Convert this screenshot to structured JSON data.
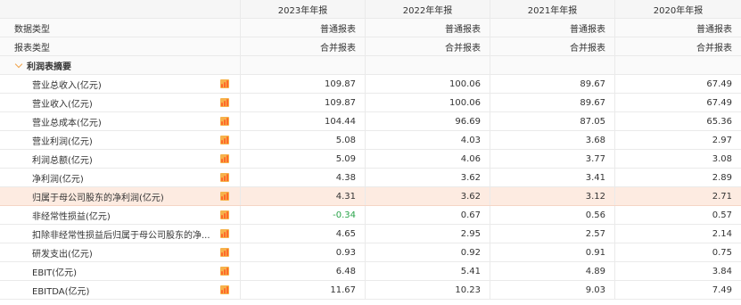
{
  "table": {
    "header": {
      "col0": "",
      "years": [
        "2023年年报",
        "2022年年报",
        "2021年年报",
        "2020年年报"
      ]
    },
    "meta_rows": [
      {
        "label": "数据类型",
        "values": [
          "普通报表",
          "普通报表",
          "普通报表",
          "普通报表"
        ]
      },
      {
        "label": "报表类型",
        "values": [
          "合并报表",
          "合并报表",
          "合并报表",
          "合并报表"
        ]
      }
    ],
    "section": {
      "title": "利润表摘要"
    },
    "rows": [
      {
        "label": "营业总收入(亿元)",
        "values": [
          "109.87",
          "100.06",
          "89.67",
          "67.49"
        ]
      },
      {
        "label": "营业收入(亿元)",
        "values": [
          "109.87",
          "100.06",
          "89.67",
          "67.49"
        ]
      },
      {
        "label": "营业总成本(亿元)",
        "values": [
          "104.44",
          "96.69",
          "87.05",
          "65.36"
        ]
      },
      {
        "label": "营业利润(亿元)",
        "values": [
          "5.08",
          "4.03",
          "3.68",
          "2.97"
        ]
      },
      {
        "label": "利润总额(亿元)",
        "values": [
          "5.09",
          "4.06",
          "3.77",
          "3.08"
        ]
      },
      {
        "label": "净利润(亿元)",
        "values": [
          "4.38",
          "3.62",
          "3.41",
          "2.89"
        ]
      },
      {
        "label": "归属于母公司股东的净利润(亿元)",
        "values": [
          "4.31",
          "3.62",
          "3.12",
          "2.71"
        ],
        "highlight": true
      },
      {
        "label": "非经常性损益(亿元)",
        "values": [
          "-0.34",
          "0.67",
          "0.56",
          "0.57"
        ]
      },
      {
        "label": "扣除非经常性损益后归属于母公司股东的净...",
        "values": [
          "4.65",
          "2.95",
          "2.57",
          "2.14"
        ]
      },
      {
        "label": "研发支出(亿元)",
        "values": [
          "0.93",
          "0.92",
          "0.91",
          "0.75"
        ]
      },
      {
        "label": "EBIT(亿元)",
        "values": [
          "6.48",
          "5.41",
          "4.89",
          "3.84"
        ]
      },
      {
        "label": "EBITDA(亿元)",
        "values": [
          "11.67",
          "10.23",
          "9.03",
          "7.49"
        ]
      }
    ]
  },
  "icons": {
    "section_toggle": "chevron-down-icon",
    "metric_chart": "bar-chart-icon"
  },
  "colors": {
    "highlight_row": "#fdebe1",
    "negative_value": "#2aa44a",
    "icon_bg": "#f6b24b",
    "icon_bar": "#ff6a2a",
    "grid": "#eaeaea",
    "header_bg": "#f6f6f6"
  }
}
